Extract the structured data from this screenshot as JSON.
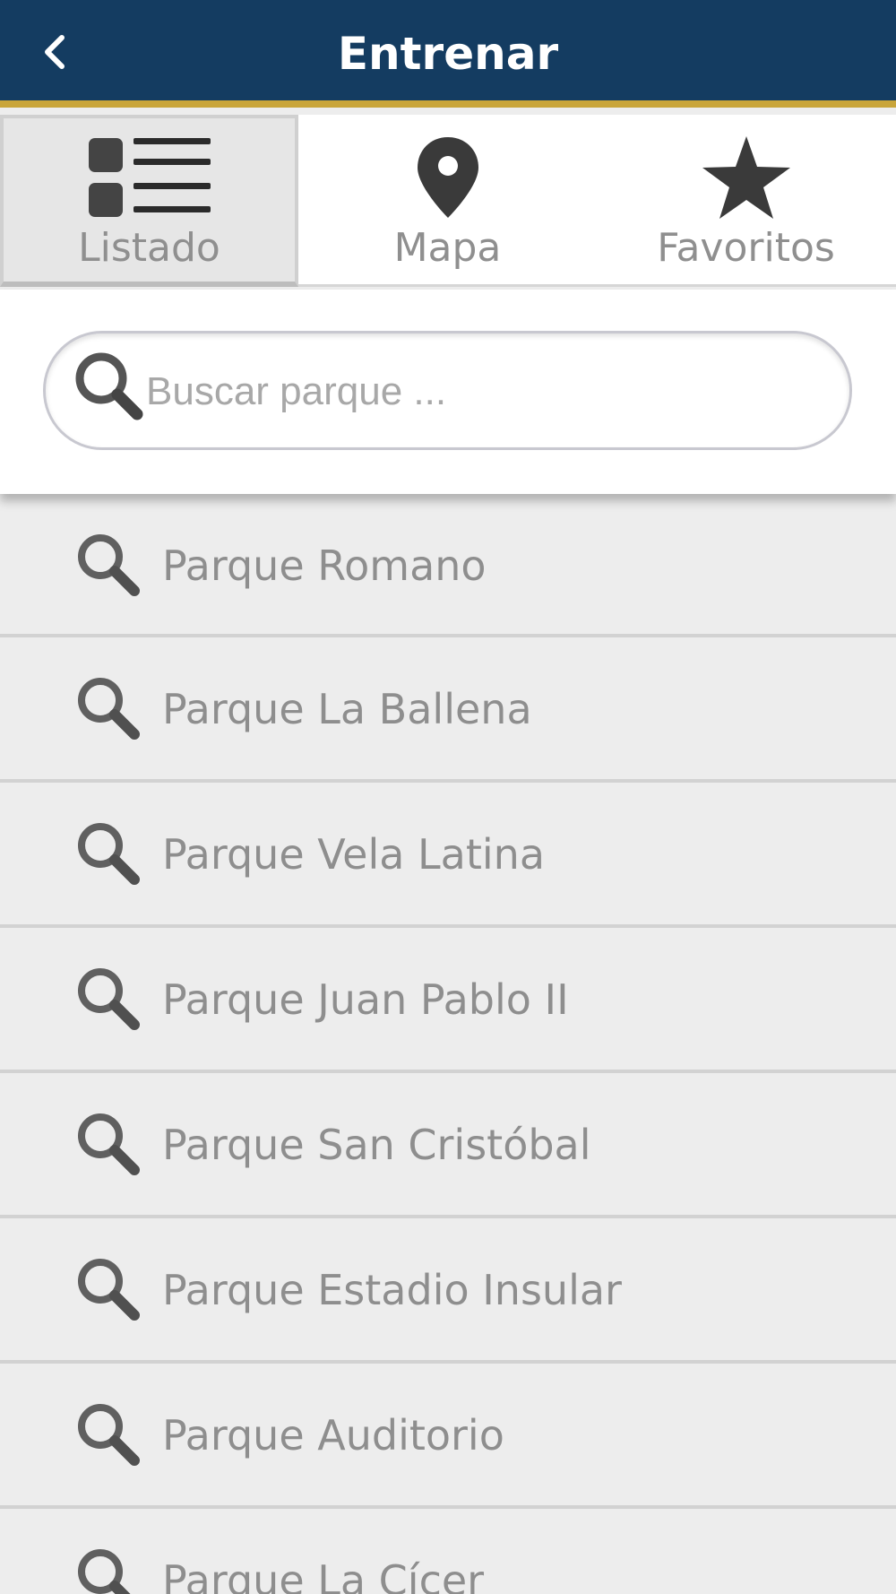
{
  "header": {
    "title": "Entrenar",
    "back_icon": "chevron-left-icon",
    "background_color": "#143c61",
    "accent_color": "#c9a53a"
  },
  "tabs": [
    {
      "label": "Listado",
      "icon": "list-icon",
      "active": true
    },
    {
      "label": "Mapa",
      "icon": "map-pin-icon",
      "active": false
    },
    {
      "label": "Favoritos",
      "icon": "star-icon",
      "active": false
    }
  ],
  "search": {
    "placeholder": "Buscar parque ...",
    "value": "",
    "icon": "search-icon"
  },
  "parks": [
    {
      "label": "Parque Romano",
      "icon": "search-icon"
    },
    {
      "label": "Parque La Ballena",
      "icon": "search-icon"
    },
    {
      "label": "Parque Vela Latina",
      "icon": "search-icon"
    },
    {
      "label": "Parque Juan Pablo II",
      "icon": "search-icon"
    },
    {
      "label": "Parque San Cristóbal",
      "icon": "search-icon"
    },
    {
      "label": "Parque Estadio Insular",
      "icon": "search-icon"
    },
    {
      "label": "Parque Auditorio",
      "icon": "search-icon"
    },
    {
      "label": "Parque La Cícer",
      "icon": "search-icon"
    }
  ]
}
